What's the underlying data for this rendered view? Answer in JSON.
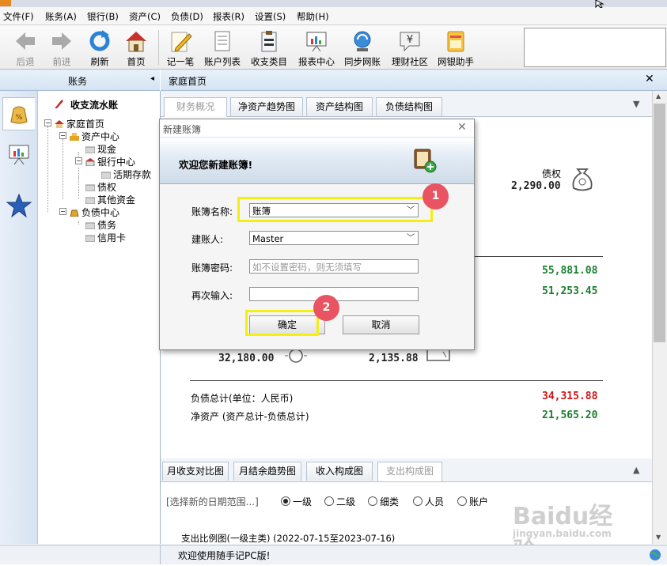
{
  "menubar": [
    "文件(F)",
    "账务(A)",
    "银行(B)",
    "资产(C)",
    "负债(D)",
    "报表(R)",
    "设置(S)",
    "帮助(H)"
  ],
  "toolbar": {
    "back": "后退",
    "forward": "前进",
    "refresh": "刷新",
    "home": "首页",
    "record": "记一笔",
    "accounts": "账户列表",
    "categories": "收支类目",
    "reports": "报表中心",
    "sync": "同步网账",
    "community": "理财社区",
    "assistant": "网银助手"
  },
  "left_panel": {
    "header": "账务",
    "tree_title": "收支流水账",
    "tree": {
      "home": "家庭首页",
      "assets": "资产中心",
      "cash": "现金",
      "bank": "银行中心",
      "deposit": "活期存款",
      "credit": "债权",
      "other": "其他资金",
      "liabilities": "负债中心",
      "debt": "债务",
      "card": "信用卡"
    }
  },
  "main": {
    "header": "家庭首页",
    "tabs": [
      "财务概况",
      "净资产趋势图",
      "资产结构图",
      "负债结构图"
    ],
    "credit_label": "债权",
    "credit_value": "2,290.00",
    "value_a": "55,881.08",
    "value_b": "51,253.45",
    "value_c": "32,180.00",
    "value_d": "2,135.88",
    "liab_total_label": "负债总计(单位：人民币)",
    "liab_total_value": "34,315.88",
    "net_label": "净资产 (资产总计-负债总计)",
    "net_value": "21,565.20",
    "bottom_tabs": [
      "月收支对比图",
      "月结余趋势图",
      "收入构成图",
      "支出构成图"
    ],
    "date_range": "[选择新的日期范围...]",
    "radios": [
      "一级",
      "二级",
      "细类",
      "人员",
      "账户"
    ],
    "chart_caption": "支出比例图(一级主类) (2022-07-15至2023-07-16)"
  },
  "dialog": {
    "title": "新建账簿",
    "banner": "欢迎您新建账簿!",
    "name_label": "账簿名称:",
    "name_value": "账簿",
    "owner_label": "建账人:",
    "owner_value": "Master",
    "password_label": "账簿密码:",
    "password_placeholder": "如不设置密码，则无须填写",
    "confirm_label": "再次输入:",
    "ok": "确定",
    "cancel": "取消"
  },
  "annotations": [
    "1",
    "2"
  ],
  "status": "欢迎使用随手记PC版!",
  "watermark": "Baidu经验",
  "watermark_sub": "jingyan.baidu.com"
}
